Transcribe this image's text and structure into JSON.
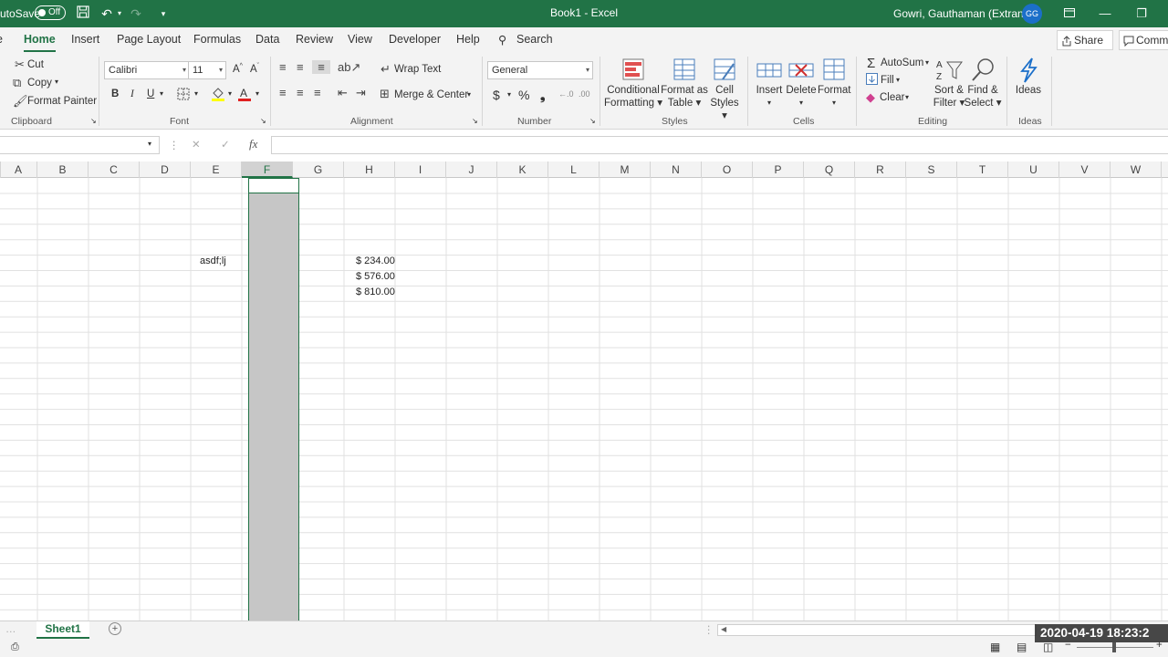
{
  "titlebar": {
    "autosave_label": "AutoSave",
    "autosave_state": "Off",
    "doc_title": "Book1  -  Excel",
    "user_name": "Gowri, Gauthaman (Extranet)",
    "avatar_initials": "GG"
  },
  "tabs": [
    "Home",
    "Insert",
    "Page Layout",
    "Formulas",
    "Data",
    "Review",
    "View",
    "Developer",
    "Help"
  ],
  "search_label": "Search",
  "share_label": "Share",
  "comments_label": "Comm",
  "clipboard": {
    "cut": "Cut",
    "copy": "Copy",
    "format_painter": "Format Painter",
    "group": "Clipboard"
  },
  "font": {
    "name": "Calibri",
    "size": "11",
    "group": "Font",
    "bold": "B",
    "italic": "I",
    "underline": "U"
  },
  "alignment": {
    "wrap_text": "Wrap Text",
    "merge_center": "Merge & Center",
    "group": "Alignment"
  },
  "number": {
    "format": "General",
    "group": "Number",
    "currency": "$",
    "percent": "%"
  },
  "styles": {
    "conditional": "Conditional",
    "conditional2": "Formatting",
    "format_as": "Format as",
    "format_as2": "Table",
    "cell": "Cell",
    "cell2": "Styles",
    "group": "Styles"
  },
  "cells": {
    "insert": "Insert",
    "delete": "Delete",
    "format": "Format",
    "group": "Cells"
  },
  "editing": {
    "autosum": "AutoSum",
    "fill": "Fill",
    "clear": "Clear",
    "sort": "Sort &",
    "sort2": "Filter",
    "find": "Find &",
    "find2": "Select",
    "group": "Editing"
  },
  "ideas": {
    "label": "Ideas",
    "group": "Ideas"
  },
  "formula_bar": {
    "fx": "fx",
    "cancel": "✕",
    "enter": "✓"
  },
  "columns": [
    "A",
    "B",
    "C",
    "D",
    "E",
    "F",
    "G",
    "H",
    "I",
    "J",
    "K",
    "L",
    "M",
    "N",
    "O",
    "P",
    "Q",
    "R",
    "S",
    "T",
    "U",
    "V",
    "W"
  ],
  "selected_column": "F",
  "cells_data": {
    "e6": "asdf;lj",
    "h6": "$ 234.00",
    "h7": "$ 576.00",
    "h8": "$ 810.00"
  },
  "sheet": {
    "name": "Sheet1",
    "add": "+"
  },
  "timestamp": "2020-04-19  18:23:2",
  "colors": {
    "excel_green": "#217346",
    "ribbon_bg": "#f3f3f3",
    "selection": "#c6c6c6"
  }
}
